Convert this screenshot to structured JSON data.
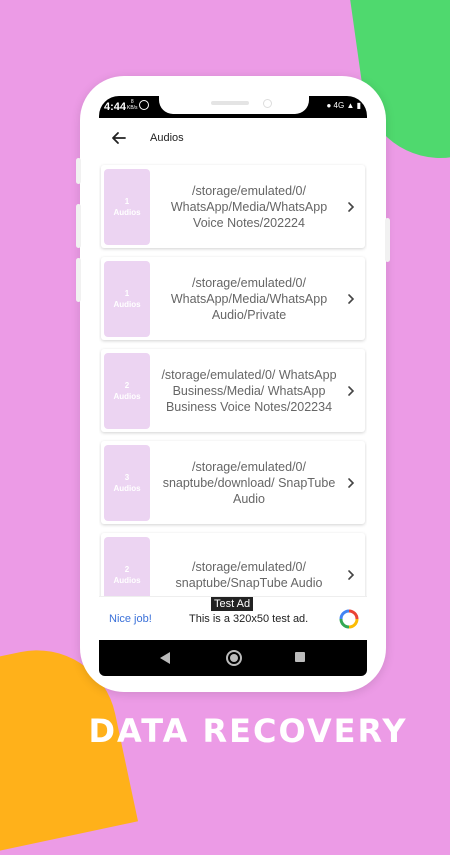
{
  "status": {
    "time": "4:44",
    "kbs_value": "8",
    "kbs_unit": "KB/s",
    "network": "4G"
  },
  "appbar": {
    "title": "Audios"
  },
  "folders": [
    {
      "count": "1",
      "unit": "Audios",
      "path": "/storage/emulated/0/ WhatsApp/Media/WhatsApp Voice Notes/202224"
    },
    {
      "count": "1",
      "unit": "Audios",
      "path": "/storage/emulated/0/ WhatsApp/Media/WhatsApp Audio/Private"
    },
    {
      "count": "2",
      "unit": "Audios",
      "path": "/storage/emulated/0/ WhatsApp Business/Media/ WhatsApp Business Voice Notes/202234"
    },
    {
      "count": "3",
      "unit": "Audios",
      "path": "/storage/emulated/0/ snaptube/download/ SnapTube Audio"
    },
    {
      "count": "2",
      "unit": "Audios",
      "path": "/storage/emulated/0/ snaptube/SnapTube Audio"
    }
  ],
  "ad": {
    "badge": "Test Ad",
    "nice": "Nice job!",
    "text": "This is a 320x50 test ad."
  },
  "caption": "DATA RECOVERY",
  "colors": {
    "background": "#ec9be6",
    "thumb": "#ecd4f2",
    "link": "#3b71d9"
  }
}
